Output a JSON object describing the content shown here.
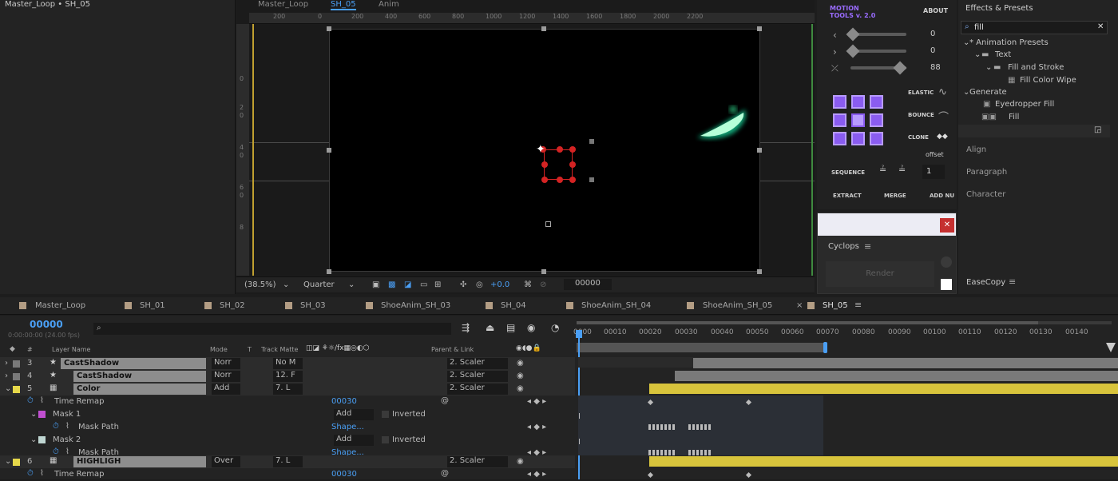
{
  "project": {
    "title": "Master_Loop • SH_05"
  },
  "comp": {
    "tabs": [
      "Master_Loop",
      "SH_05",
      "Anim"
    ],
    "ruler_top": [
      "200",
      "0",
      "200",
      "400",
      "600",
      "800",
      "1000",
      "1200",
      "1400",
      "1600",
      "1800",
      "2000",
      "2200"
    ],
    "ruler_left": [
      "0",
      "2",
      "0",
      "4",
      "0",
      "6",
      "0",
      "8"
    ],
    "zoom": "(38.5%)",
    "resolution": "Quarter",
    "exposure": "+0.0",
    "timecode": "00000"
  },
  "motion_tools": {
    "title": "MOTION TOOLS v. 2.0",
    "about": "ABOUT",
    "sliders": [
      {
        "icon": "‹",
        "value": "0"
      },
      {
        "icon": "›",
        "value": "0"
      },
      {
        "icon": "⤫",
        "value": "88"
      }
    ],
    "elastic": "ELASTIC",
    "bounce": "BOUNCE",
    "clone": "CLONE",
    "offset": "offset",
    "sequence": "SEQUENCE",
    "sequence_value": "1",
    "extract": "EXTRACT",
    "merge": "MERGE",
    "add_null": "ADD NU"
  },
  "cyclops": {
    "title": "Cyclops",
    "render": "Render"
  },
  "effects": {
    "title": "Effects & Presets",
    "search": "fill",
    "tree": [
      {
        "label": "* Animation Presets",
        "indent": 0,
        "type": "folder-open"
      },
      {
        "label": "Text",
        "indent": 1,
        "type": "folder"
      },
      {
        "label": "Fill and Stroke",
        "indent": 2,
        "type": "folder"
      },
      {
        "label": "Fill Color Wipe",
        "indent": 3,
        "type": "preset"
      },
      {
        "label": "Generate",
        "indent": 0,
        "type": "category"
      },
      {
        "label": "Eyedropper Fill",
        "indent": 1,
        "type": "effect"
      },
      {
        "label": "Fill",
        "indent": 1,
        "type": "effect"
      }
    ],
    "sections": [
      "Align",
      "Paragraph",
      "Character",
      "EaseCopy"
    ]
  },
  "timeline": {
    "tabs": [
      "Master_Loop",
      "SH_01",
      "SH_02",
      "SH_03",
      "ShoeAnim_SH_03",
      "SH_04",
      "ShoeAnim_SH_04",
      "ShoeAnim_SH_05",
      "SH_05"
    ],
    "active_tab": "SH_05",
    "timecode": "00000",
    "timecode_sub": "0:00:00:00 (24.00 fps)",
    "search_placeholder": "",
    "columns": {
      "num": "#",
      "layer_name": "Layer Name",
      "mode": "Mode",
      "t": "T",
      "track_matte": "Track Matte",
      "parent": "Parent & Link"
    },
    "ruler": [
      "0000",
      "00010",
      "00020",
      "00030",
      "00040",
      "00050",
      "00060",
      "00070",
      "00080",
      "00090",
      "00100",
      "00110",
      "00120",
      "00130",
      "00140"
    ],
    "layers": [
      {
        "num": "3",
        "name": "CastShadow",
        "mode": "Norr",
        "matte": "No M",
        "parent": "2. Scaler"
      },
      {
        "num": "4",
        "name": "CastShadow",
        "mode": "Norr",
        "matte": "12. F",
        "parent": "2. Scaler"
      },
      {
        "num": "5",
        "name": "Color",
        "mode": "Add",
        "matte": "7. L",
        "parent": "2. Scaler"
      }
    ],
    "props": [
      {
        "label": "Time Remap",
        "value": "00030"
      },
      {
        "label": "Mask 1",
        "mode": "Add",
        "inverted": "Inverted"
      },
      {
        "label": "Mask Path",
        "value": "Shape..."
      },
      {
        "label": "Mask 2",
        "mode": "Add",
        "inverted": "Inverted"
      },
      {
        "label": "Mask Path",
        "value": "Shape..."
      }
    ],
    "layer6": {
      "num": "6",
      "name": "HIGHLIGH",
      "mode": "Over",
      "matte": "7. L",
      "parent": "2. Scaler"
    },
    "prop_last": {
      "label": "Time Remap",
      "value": "00030"
    }
  }
}
